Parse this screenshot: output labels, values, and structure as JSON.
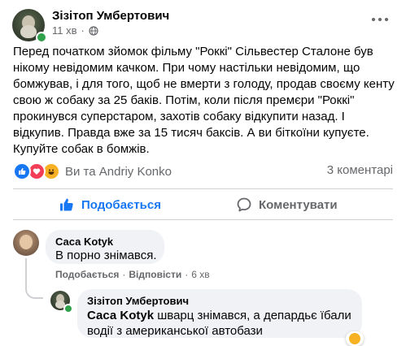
{
  "post": {
    "author": "Зізітоп Умбертович",
    "time": "11 хв",
    "separator": "·",
    "text": "Перед початком зйомок фільму \"Роккі\" Сільвестер Сталоне був нікому невідомим качком. При чому настільки невідомим, що бомжував, і для того, щоб не вмерти з голоду, продав своєму кенту свою ж собаку за 25 баків. Потім, коли після премєри \"Роккі\" прокинувся суперстаром, захотів собаку відкупити назад. І відкупив. Правда вже за 15 тисяч баксів. А ви біткоїни купуєте. Купуйте собак в бомжів.",
    "reactions_text": "Ви та Andriy Konko",
    "comments_count": "3 коментарі",
    "like_label": "Подобається",
    "comment_label": "Коментувати"
  },
  "comments": [
    {
      "author": "Саса Kotyk",
      "text": "В порно знімався.",
      "like_label": "Подобається",
      "reply_label": "Відповісти",
      "time": "6 хв",
      "separator": "·"
    },
    {
      "author": "Зізітоп Умбертович",
      "tag": "Саса Kotyk",
      "text": " шварц знімався, а депардьє їбали водії з американської автобази"
    }
  ],
  "colors": {
    "accent": "#1877f2",
    "love": "#f33e58",
    "haha": "#f7b125",
    "online": "#31a24c",
    "muted": "#65676b",
    "bubble": "#f0f2f5"
  },
  "icons": [
    "globe-icon",
    "more-icon",
    "like-reaction-icon",
    "love-reaction-icon",
    "haha-reaction-icon",
    "thumbs-up-icon",
    "comment-icon"
  ]
}
